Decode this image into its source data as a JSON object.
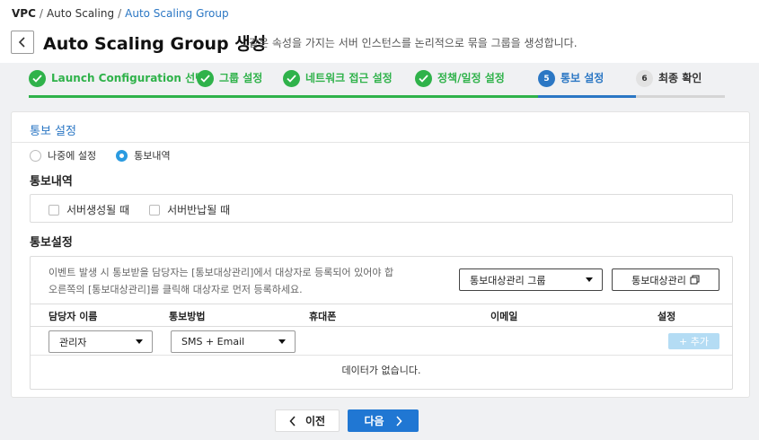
{
  "breadcrumb": {
    "items": [
      "VPC",
      "Auto Scaling",
      "Auto Scaling Group"
    ]
  },
  "header": {
    "title": "Auto Scaling Group 생성",
    "description": "같은 속성을 가지는 서버 인스턴스를 논리적으로 묶을 그룹을 생성합니다."
  },
  "steps": [
    {
      "label": "Launch Configuration 선택",
      "state": "done"
    },
    {
      "label": "그룹 설정",
      "state": "done"
    },
    {
      "label": "네트워크 접근 설정",
      "state": "done"
    },
    {
      "label": "정책/일정 설정",
      "state": "done"
    },
    {
      "number": "5",
      "label": "통보 설정",
      "state": "active"
    },
    {
      "number": "6",
      "label": "최종 확인",
      "state": "todo"
    }
  ],
  "notification": {
    "section_title": "통보 설정",
    "radio_options": [
      {
        "label": "나중에 설정",
        "checked": false
      },
      {
        "label": "통보내역",
        "checked": true
      }
    ],
    "history_title": "통보내역",
    "history_checks": [
      {
        "label": "서버생성될 때",
        "checked": false
      },
      {
        "label": "서버반납될 때",
        "checked": false
      }
    ],
    "settings_title": "통보설정",
    "notice_line1": "이벤트 발생 시 통보받을 담당자는 [통보대상관리]에서 대상자로 등록되어 있어야 합",
    "notice_line2": "오른쪽의 [통보대상관리]를 클릭해 대상자로 먼저 등록하세요.",
    "target_group_select": "통보대상관리 그룹",
    "manage_button": "통보대상관리",
    "table": {
      "headers": [
        "담당자 이름",
        "통보방법",
        "휴대폰",
        "이메일",
        "설정"
      ],
      "row": {
        "manager": "관리자",
        "method": "SMS + Email"
      },
      "add_button": "+ 추가",
      "empty_text": "데이터가 없습니다."
    }
  },
  "footer": {
    "prev_label": "이전",
    "next_label": "다음"
  },
  "colors": {
    "accent": "#2b77c4",
    "done": "#2fb24a",
    "primary_button": "#2077d3"
  }
}
